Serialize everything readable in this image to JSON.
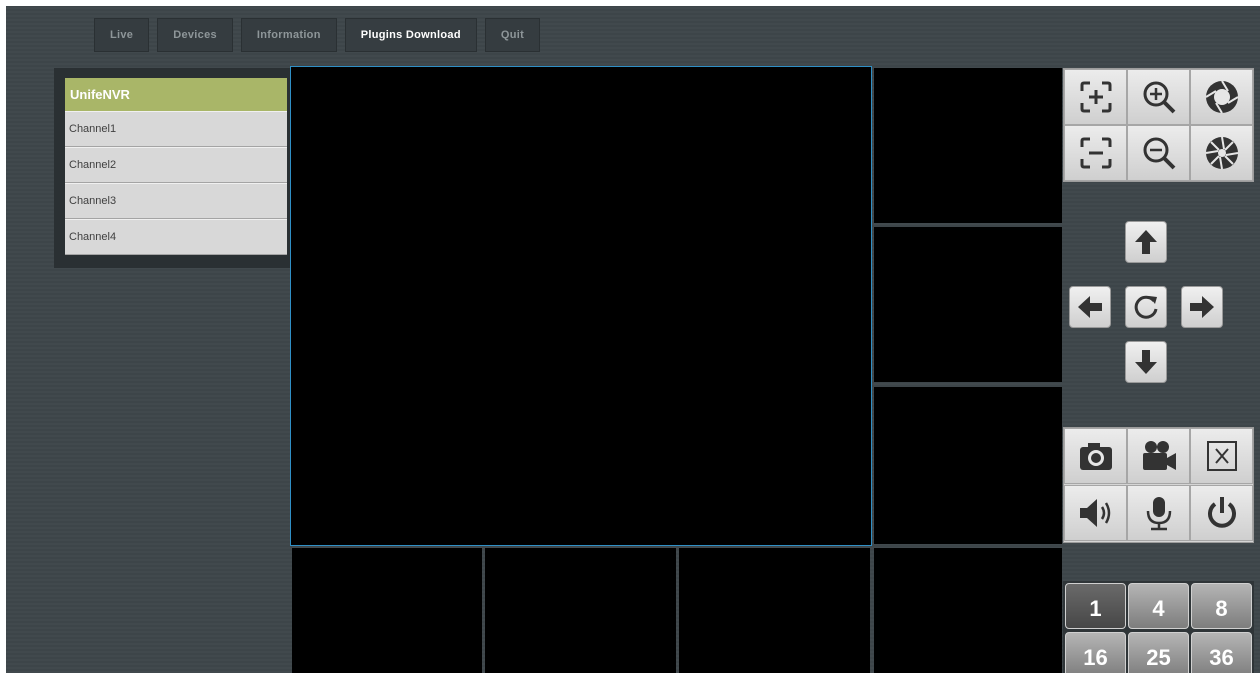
{
  "nav": {
    "items": [
      {
        "label": "Live",
        "active": false
      },
      {
        "label": "Devices",
        "active": false
      },
      {
        "label": "Information",
        "active": false
      },
      {
        "label": "Plugins Download",
        "active": true
      },
      {
        "label": "Quit",
        "active": false
      }
    ]
  },
  "panel": {
    "title": "UnifeNVR",
    "channels": [
      "Channel1",
      "Channel2",
      "Channel3",
      "Channel4"
    ]
  },
  "controls": {
    "lens": [
      "zoom-in-frame-icon",
      "magnify-plus-icon",
      "iris-open-icon",
      "zoom-out-frame-icon",
      "magnify-minus-icon",
      "iris-close-icon"
    ],
    "ptz": [
      "arrow-up-icon",
      "arrow-left-icon",
      "refresh-icon",
      "arrow-right-icon",
      "arrow-down-icon"
    ],
    "media": [
      "camera-icon",
      "video-camera-icon",
      "close-box-icon",
      "speaker-icon",
      "microphone-icon",
      "power-icon"
    ],
    "layouts": [
      "1",
      "4",
      "8",
      "16",
      "25",
      "36"
    ]
  },
  "colors": {
    "accent_header": "#a9b668",
    "selected_border": "#2f8fc6",
    "background": "#3e464a"
  }
}
